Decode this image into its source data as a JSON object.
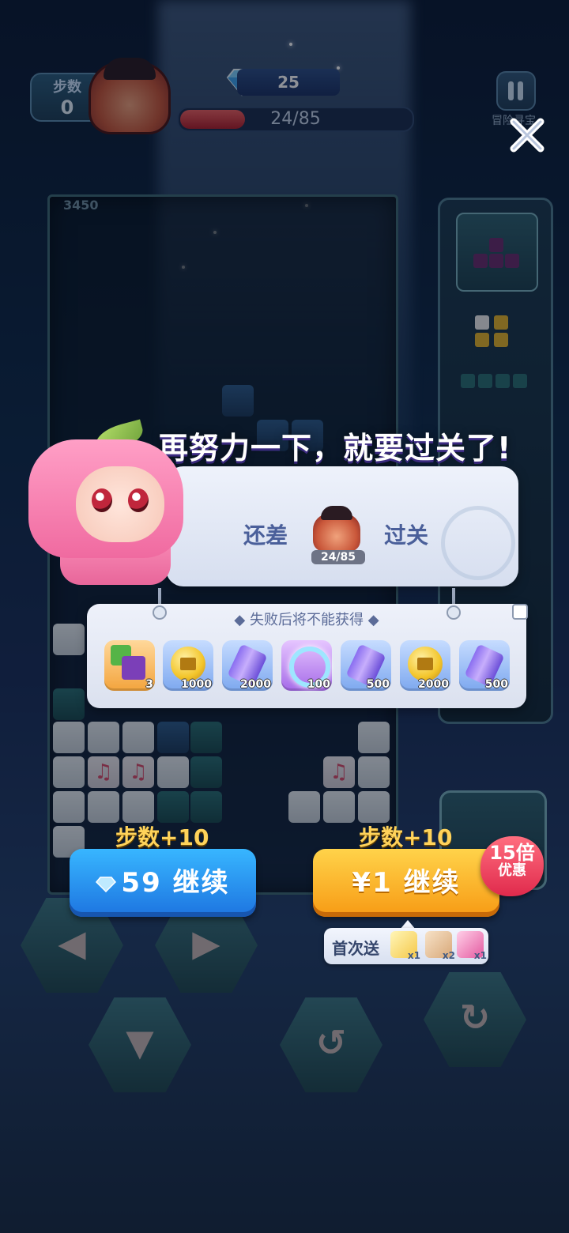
{
  "hud": {
    "steps_label": "步数",
    "steps_value": "0",
    "gems": "25",
    "progress_text": "24/85",
    "progress_fraction": 0.28,
    "adventure_label": "冒险寻宝"
  },
  "board": {
    "score": "3450"
  },
  "dialog": {
    "title": "再努力一下，就要过关了!",
    "need_prefix": "还差",
    "need_suffix": "过关",
    "boss_count": "24/85",
    "lose_title": "失败后将不能获得",
    "rewards": [
      {
        "icon": "cube-pack-icon",
        "amount": "3"
      },
      {
        "icon": "gold-coin-icon",
        "amount": "1000"
      },
      {
        "icon": "battery-icon",
        "amount": "2000"
      },
      {
        "icon": "ring-icon",
        "amount": "100"
      },
      {
        "icon": "battery-icon",
        "amount": "500"
      },
      {
        "icon": "gold-coin-icon",
        "amount": "2000"
      },
      {
        "icon": "battery-icon",
        "amount": "500"
      }
    ]
  },
  "continue": {
    "gem_steps": "步数+10",
    "gem_price": "59",
    "gem_label": "继续",
    "pay_steps": "步数+10",
    "pay_label": "¥1 继续",
    "badge_top": "15倍",
    "badge_bottom": "优惠",
    "first_gift": "首次送",
    "gift_items": [
      {
        "icon": "paper-plane-icon",
        "count": "x1"
      },
      {
        "icon": "scroll-icon",
        "count": "x2"
      },
      {
        "icon": "potion-icon",
        "count": "x1"
      }
    ]
  },
  "colors": {
    "accent_blue": "#1d74e0",
    "accent_yellow": "#f79a14",
    "badge_red": "#e02a4c"
  }
}
